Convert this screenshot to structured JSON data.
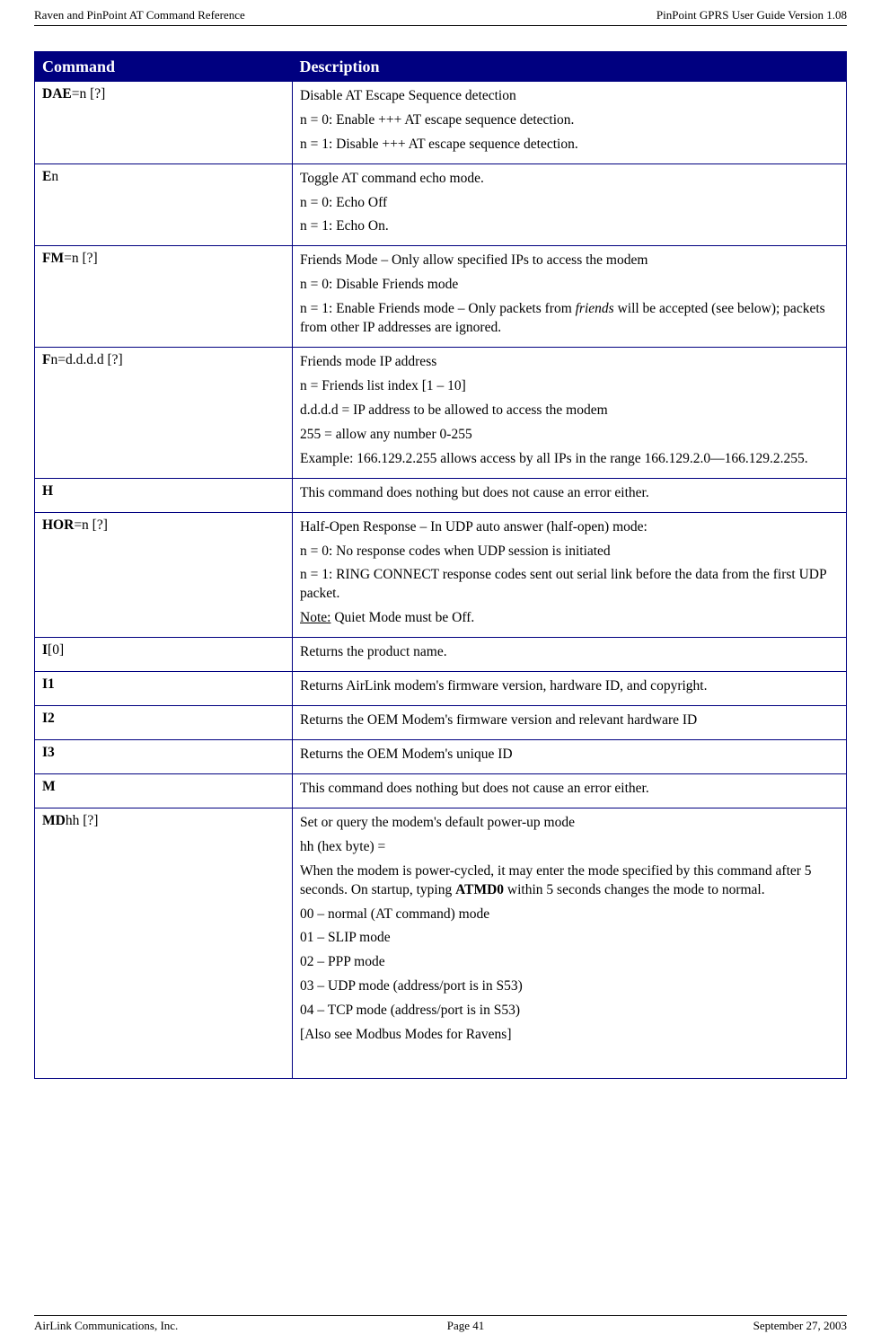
{
  "header": {
    "left": "Raven and PinPoint AT Command Reference",
    "right": "PinPoint GPRS User Guide Version 1.08"
  },
  "footer": {
    "left": "AirLink Communications, Inc.",
    "center": "Page 41",
    "right": "September 27, 2003"
  },
  "table": {
    "col1": "Command",
    "col2": "Description",
    "rows": {
      "dae": {
        "cmd_b": "DAE",
        "cmd_rest": "=n [?]",
        "d1": "Disable AT Escape Sequence detection",
        "d2": "n = 0: Enable +++ AT escape sequence detection.",
        "d3": "n = 1: Disable +++ AT escape sequence detection."
      },
      "en": {
        "cmd_b": "E",
        "cmd_rest": "n",
        "d1": "Toggle AT command echo mode.",
        "d2": "n = 0: Echo Off",
        "d3": "n = 1: Echo On."
      },
      "fm": {
        "cmd_b": "FM",
        "cmd_rest": "=n [?]",
        "d1": "Friends Mode – Only allow specified IPs to access the modem",
        "d2": "n = 0: Disable Friends mode",
        "d3a": "n = 1: Enable Friends mode – Only packets from ",
        "d3i": "friends",
        "d3b": " will be accepted (see below); packets from other IP addresses are ignored."
      },
      "fn": {
        "cmd_b": "F",
        "cmd_rest": "n=d.d.d.d [?]",
        "d1": "Friends mode IP address",
        "d2": "n = Friends list index [1 – 10]",
        "d3": "d.d.d.d = IP address to be allowed to access the modem",
        "d4": "255 = allow any number 0-255",
        "d5": "Example: 166.129.2.255 allows access by all IPs in the range 166.129.2.0—166.129.2.255."
      },
      "h": {
        "cmd_b": "H",
        "d1": "This command does nothing but does not cause an error either."
      },
      "hor": {
        "cmd_b": "HOR",
        "cmd_rest": "=n [?]",
        "d1": "Half-Open Response – In UDP auto answer (half-open) mode:",
        "d2": "n = 0: No response codes when UDP session is initiated",
        "d3": "n = 1: RING CONNECT response codes sent out serial link before the data from the first UDP packet.",
        "d4u": "Note:",
        "d4r": " Quiet Mode must be Off."
      },
      "i0": {
        "cmd_b": "I",
        "cmd_rest": "[0]",
        "d1": "Returns the product name."
      },
      "i1": {
        "cmd_b": "I1",
        "d1": "Returns AirLink modem's firmware version, hardware ID, and copyright."
      },
      "i2": {
        "cmd_b": "I2",
        "d1": "Returns the OEM Modem's firmware version and relevant hardware ID"
      },
      "i3": {
        "cmd_b": "I3",
        "d1": "Returns the OEM Modem's unique ID"
      },
      "m": {
        "cmd_b": "M",
        "d1": "This command does nothing but does not cause an error either."
      },
      "md": {
        "cmd_b": "MD",
        "cmd_rest": "hh [?]",
        "d1": "Set or query the modem's default power-up mode",
        "d2": "hh (hex byte) =",
        "d3a": "When the modem is power-cycled, it may enter the mode specified by this command after 5 seconds. On startup, typing ",
        "d3b": "ATMD0",
        "d3c": " within 5 seconds changes the mode to normal.",
        "d4": "00 – normal (AT command) mode",
        "d5": "01 – SLIP mode",
        "d6": "02 – PPP mode",
        "d7": "03 – UDP mode (address/port is in S53)",
        "d8": "04 – TCP mode (address/port is in S53)",
        "d9": "[Also see Modbus Modes for Ravens]"
      }
    }
  }
}
